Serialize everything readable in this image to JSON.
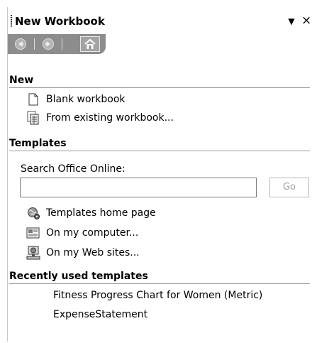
{
  "pane": {
    "title": "New Workbook",
    "dropdown_glyph": "▼",
    "close_glyph": "×"
  },
  "nav": {
    "back_icon": "back-arrow-icon",
    "forward_icon": "forward-arrow-icon",
    "home_icon": "home-icon"
  },
  "sections": {
    "new": {
      "header": "New",
      "items": [
        {
          "label": "Blank workbook",
          "icon": "blank-document-icon"
        },
        {
          "label": "From existing workbook...",
          "icon": "existing-workbook-icon"
        }
      ]
    },
    "templates": {
      "header": "Templates",
      "search_label": "Search Office Online:",
      "search_value": "",
      "go_label": "Go",
      "items": [
        {
          "label": "Templates home page",
          "icon": "globe-icon"
        },
        {
          "label": "On my computer...",
          "icon": "computer-templates-icon"
        },
        {
          "label": "On my Web sites...",
          "icon": "web-sites-icon"
        }
      ]
    },
    "recent": {
      "header": "Recently used templates",
      "items": [
        {
          "label": "Fitness Progress Chart for Women (Metric)"
        },
        {
          "label": "ExpenseStatement"
        }
      ]
    }
  }
}
